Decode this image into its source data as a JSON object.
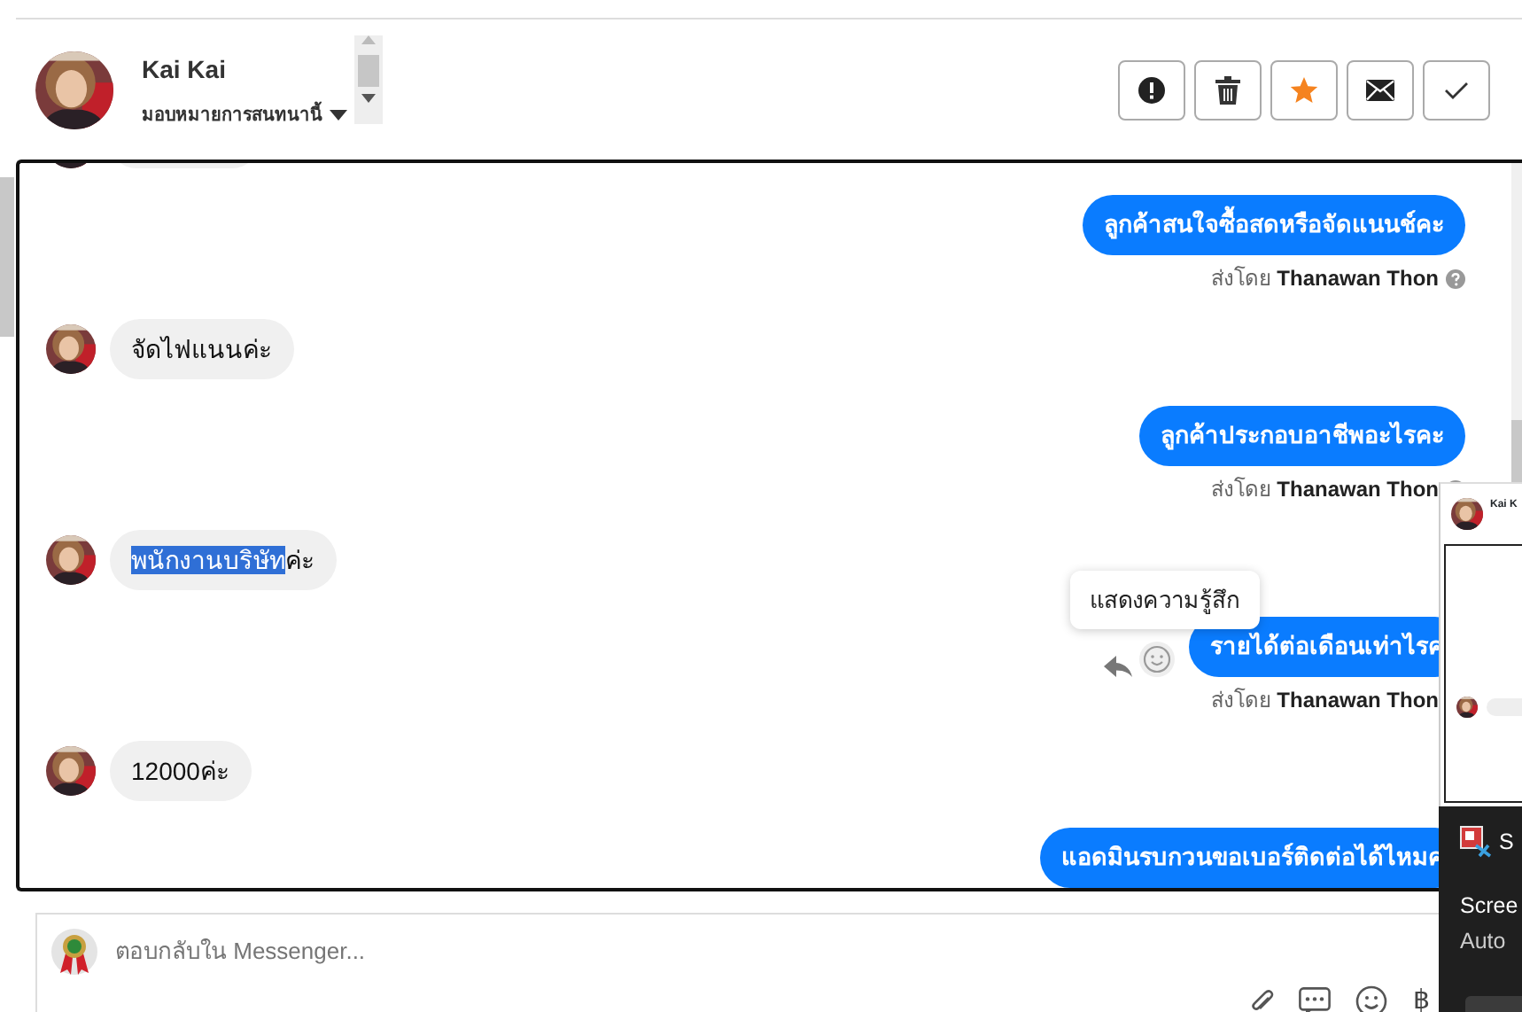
{
  "header": {
    "name": "Kai Kai",
    "assign_label": "มอบหมายการสนทนานี้"
  },
  "actions": [
    {
      "kind": "spam"
    },
    {
      "kind": "delete"
    },
    {
      "kind": "star",
      "on": true
    },
    {
      "kind": "unread"
    },
    {
      "kind": "done"
    }
  ],
  "messages": [
    {
      "kind": "partial"
    },
    {
      "kind": "outgoing",
      "text": "ลูกค้าสนใจซื้อสดหรือจัดแนนช์คะ",
      "sent_by_label": "ส่งโดย",
      "sender": "Thanawan Thon",
      "help_icon": true,
      "reactions_shown": false
    },
    {
      "kind": "incoming",
      "parts": [
        {
          "text": "จัดไฟแนนค่ะ",
          "highlighted": false
        }
      ]
    },
    {
      "kind": "outgoing",
      "text": "ลูกค้าประกอบอาชีพอะไรคะ",
      "sent_by_label": "ส่งโดย",
      "sender": "Thanawan Thon",
      "help_icon": true,
      "reactions_shown": false
    },
    {
      "kind": "incoming",
      "parts": [
        {
          "text": "พนักงานบริษัท",
          "highlighted": true
        },
        {
          "text": "ค่ะ",
          "highlighted": false
        }
      ]
    },
    {
      "kind": "outgoing",
      "text": "รายได้ต่อเดือนเท่าไรค",
      "sent_by_label": "ส่งโดย",
      "sender": "Thanawan Thon",
      "help_icon": false,
      "reactions_shown": true,
      "tooltip": "แสดงความรู้สึก"
    },
    {
      "kind": "incoming",
      "parts": [
        {
          "text": "12000ค่ะ",
          "highlighted": false
        }
      ]
    },
    {
      "kind": "outgoing",
      "text": "แอดมินรบกวนขอเบอร์ติดต่อได้ไหมค",
      "reactions_shown": false
    }
  ],
  "composer": {
    "placeholder": "ตอบกลับใน Messenger...",
    "currency_symbol": "฿"
  },
  "snip_notification": {
    "thumbnail_title": "Kai K",
    "app_letter": "S",
    "title": "Scree",
    "subtitle": "Auto"
  }
}
